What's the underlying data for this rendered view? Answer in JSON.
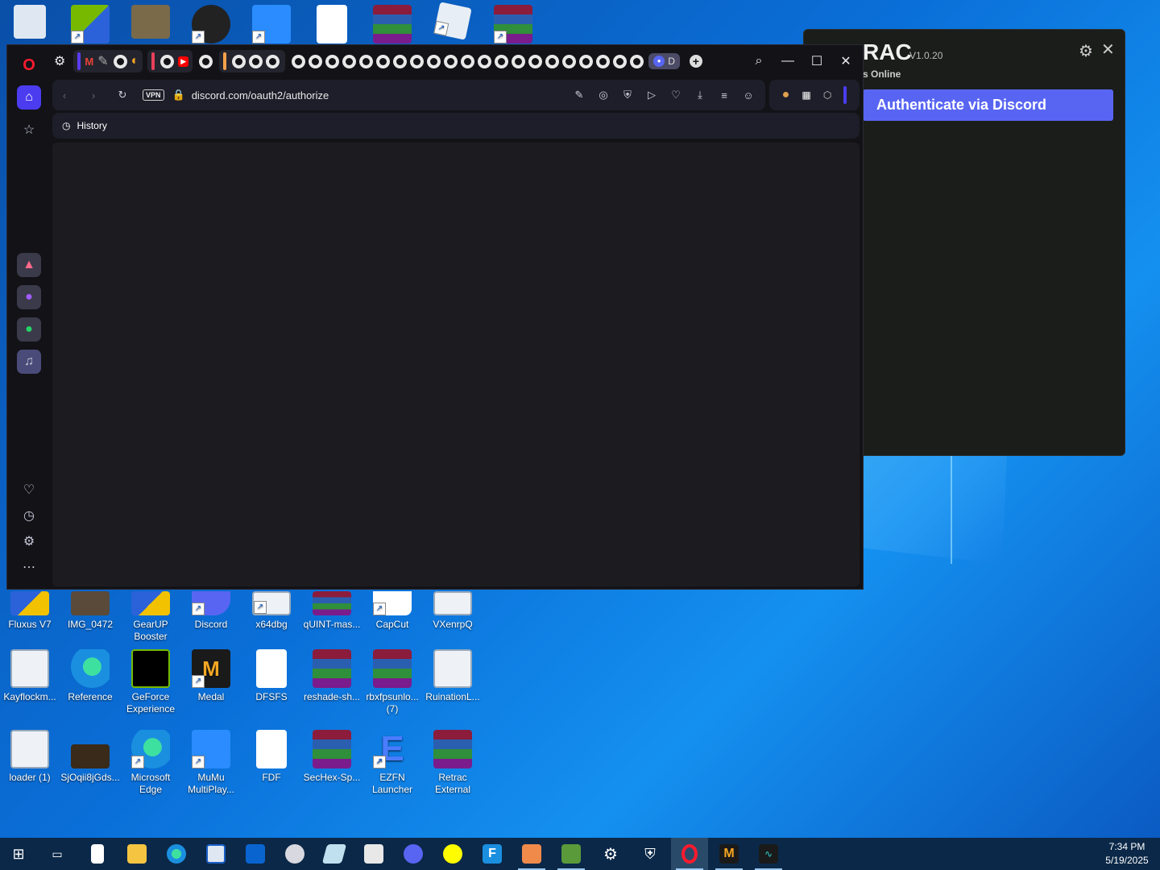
{
  "desktop": {
    "icons_top_row": [
      {
        "name": "recycle-bin-icon"
      },
      {
        "name": "nvidia-shortcut-icon"
      },
      {
        "name": "photo-icon"
      },
      {
        "name": "obs-icon"
      },
      {
        "name": "mumu-icon"
      },
      {
        "name": "blank-file-icon"
      },
      {
        "name": "winrar-archive-icon"
      },
      {
        "name": "roblox-icon"
      },
      {
        "name": "winrar-admin-icon"
      }
    ],
    "icons_row1": [
      "Fluxus V7",
      "IMG_0472",
      "GearUP Booster",
      "Discord",
      "x64dbg",
      "qUINT-mas...",
      "CapCut",
      "VXenrpQ"
    ],
    "icons_row2": [
      "Kayflockm...",
      "Reference",
      "GeForce Experience",
      "Medal",
      "DFSFS",
      "reshade-sh...",
      "rbxfpsunlo... (7)",
      "RuinationL..."
    ],
    "icons_row3": [
      "loader (1)",
      "SjOqii8jGds...",
      "Microsoft Edge",
      "MuMu MultiPlay...",
      "FDF",
      "SecHex-Sp...",
      "EZFN Launcher",
      "Retrac External"
    ]
  },
  "browser": {
    "address": "discord.com/oauth2/authorize",
    "vpn_label": "VPN",
    "bookmark_label": "History",
    "active_tab_label": "D",
    "accent": "#5b3cf0"
  },
  "rac": {
    "title": "RAC",
    "version": "V1.0.20",
    "status": "s Online",
    "auth_button": "Authenticate via Discord",
    "accent": "#5865f2"
  },
  "taskbar": {
    "time": "7:34 PM",
    "date": "5/19/2025"
  }
}
